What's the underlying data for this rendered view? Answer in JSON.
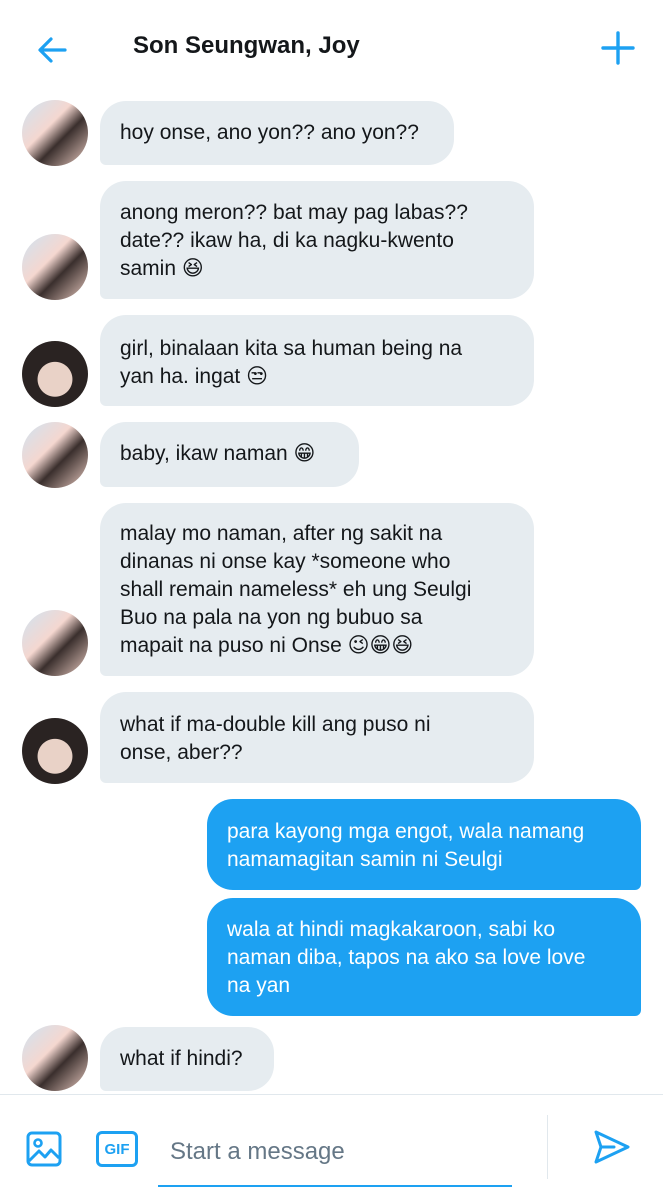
{
  "header": {
    "title": "Son Seungwan, Joy",
    "back_icon": "arrow-left-icon",
    "add_icon": "plus-icon"
  },
  "colors": {
    "accent": "#1da1f2",
    "incoming_bubble": "#e6ecf0",
    "text": "#14171a",
    "placeholder": "#657786"
  },
  "messages": [
    {
      "direction": "incoming",
      "sender_avatar": "group-photo-avatar",
      "lines": [
        "hoy onse, ano yon?? ano yon??"
      ]
    },
    {
      "direction": "incoming",
      "sender_avatar": "group-photo-avatar",
      "lines": [
        "anong meron?? bat may pag labas??",
        "date?? ikaw ha, di ka nagku-kwento",
        "samin 😆"
      ]
    },
    {
      "direction": "incoming",
      "sender_avatar": "portrait-avatar",
      "lines": [
        "girl, binalaan kita sa human being na",
        "yan ha. ingat 😒"
      ]
    },
    {
      "direction": "incoming",
      "sender_avatar": "group-photo-avatar",
      "lines": [
        "baby, ikaw naman 😁"
      ]
    },
    {
      "direction": "incoming",
      "sender_avatar": "group-photo-avatar",
      "lines": [
        "malay mo naman, after ng sakit na",
        "dinanas ni onse kay *someone who",
        "shall remain nameless* eh ung Seulgi",
        "Buo na pala na yon ng bubuo sa",
        "mapait na puso ni Onse 😉😁😆"
      ]
    },
    {
      "direction": "incoming",
      "sender_avatar": "portrait-avatar",
      "lines": [
        "what if ma-double kill ang puso ni",
        "onse, aber??"
      ]
    },
    {
      "direction": "outgoing",
      "lines": [
        "para kayong mga engot, wala namang",
        "namamagitan samin ni Seulgi"
      ]
    },
    {
      "direction": "outgoing",
      "lines": [
        "wala at hindi magkakaroon, sabi ko",
        "naman diba, tapos na ako sa love love",
        "na yan"
      ]
    },
    {
      "direction": "incoming",
      "sender_avatar": "group-photo-avatar",
      "lines": [
        "what if hindi?"
      ]
    }
  ],
  "composer": {
    "placeholder": "Start a message",
    "gif_label": "GIF",
    "media_icon": "image-icon",
    "send_icon": "send-icon"
  }
}
